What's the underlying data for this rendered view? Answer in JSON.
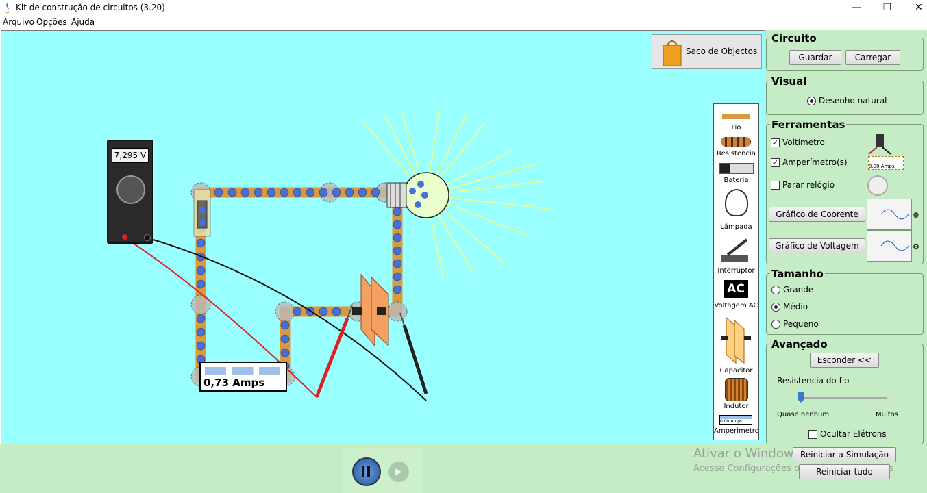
{
  "window": {
    "title": "Kit de construção de circuitos (3.20)"
  },
  "menu": [
    "Arquivo",
    "Opções",
    "Ajuda"
  ],
  "bag": {
    "label": "Saco de Objectos"
  },
  "meters": {
    "voltmeter_reading": "7,295 V",
    "ammeter_reading": "0,73 Amps"
  },
  "toolbox": {
    "fio": "Fio",
    "resistencia": "Resistencia",
    "bateria": "Bateria",
    "lampada": "Lâmpada",
    "interruptor": "Interruptor",
    "ac_icon_text": "AC",
    "voltagem_ac": "Voltagem AC",
    "capacitor": "Capacitor",
    "indutor": "Indutor",
    "amperimetro": "Amperimetro",
    "amperimetro_icon_text": "0.00 Amps"
  },
  "sidebar": {
    "circuito": {
      "title": "Circuito",
      "guardar": "Guardar",
      "carregar": "Carregar"
    },
    "visual": {
      "title": "Visual",
      "option": "Desenho natural",
      "selected": true
    },
    "ferramentas": {
      "title": "Ferramentas",
      "voltimetro": {
        "label": "Voltímetro",
        "checked": true
      },
      "amperimetro": {
        "label": "Amperímetro(s)",
        "checked": true,
        "icon_text": "0.00 Amps"
      },
      "parar_relogio": {
        "label": "Parar relógio",
        "checked": false
      },
      "grafico_corrente": "Gráfico de Coorente",
      "grafico_voltagem": "Gráfico de Voltagem"
    },
    "tamanho": {
      "title": "Tamanho",
      "options": [
        "Grande",
        "Médio",
        "Pequeno"
      ],
      "selected": "Médio"
    },
    "avancado": {
      "title": "Avançado",
      "esconder": "Esconder <<",
      "resistencia_fio": "Resistencia do fio",
      "slider_min": "Quase nenhum",
      "slider_max": "Muitos",
      "slider_value": 0,
      "ocultar_eletrons": {
        "label": "Ocultar Elétrons",
        "checked": false
      }
    }
  },
  "bottom": {
    "reiniciar_simulacao": "Reiniciar a Simulação",
    "reiniciar_tudo": "Reiniciar tudo"
  },
  "watermark": {
    "line1": "Ativar o Windows",
    "line2": "Acesse Configurações para ativar o Windows."
  },
  "colors": {
    "canvas": "#99ffff",
    "panel": "#c6ecc6",
    "wire": "#d89a3c",
    "electron": "#4a6fd4"
  }
}
